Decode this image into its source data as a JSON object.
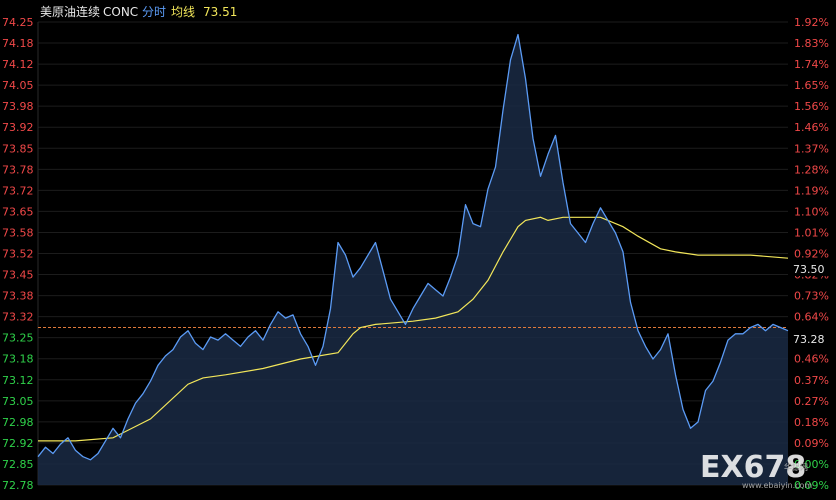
{
  "header": {
    "instrument": "美原油连续",
    "code": "CONC",
    "mode_label": "分时",
    "avg_label": "均线",
    "avg_value": "73.51"
  },
  "tags": {
    "avg_tag": "73.50",
    "price_tag": "73.28"
  },
  "watermark": {
    "brand": "EX678",
    "site_small": "www.ebaiyin.com",
    "cn_text": "华银网"
  },
  "colors": {
    "background": "#000000",
    "price_line": "#5b9bf5",
    "price_fill": "#1a2a44",
    "avg_line": "#f2e65a",
    "up": "#f04848",
    "down": "#2fd24a",
    "reference_line": "#e07a3a",
    "grid": "#1c1c1c"
  },
  "chart_data": {
    "type": "area",
    "title": "",
    "xlabel": "",
    "ylabel": "",
    "reference_price": 73.28,
    "ylim": [
      72.78,
      74.25
    ],
    "left_ticks": [
      "74.25",
      "74.18",
      "74.12",
      "74.05",
      "73.98",
      "73.92",
      "73.85",
      "73.78",
      "73.72",
      "73.65",
      "73.58",
      "73.52",
      "73.45",
      "73.38",
      "73.32",
      "73.25",
      "73.18",
      "73.12",
      "73.05",
      "72.98",
      "72.92",
      "72.85",
      "72.78"
    ],
    "right_ticks": [
      "1.92%",
      "1.83%",
      "1.74%",
      "1.65%",
      "1.56%",
      "1.46%",
      "1.37%",
      "1.28%",
      "1.19%",
      "1.10%",
      "1.01%",
      "0.92%",
      "0.82%",
      "0.73%",
      "0.64%",
      "0.55%",
      "0.46%",
      "0.37%",
      "0.27%",
      "0.18%",
      "0.09%",
      "0.00%",
      "0.09%"
    ],
    "series": [
      {
        "name": "分时",
        "x": [
          0,
          2,
          4,
          6,
          8,
          10,
          12,
          14,
          16,
          18,
          20,
          22,
          24,
          26,
          28,
          30,
          32,
          34,
          36,
          38,
          40,
          42,
          44,
          46,
          48,
          50,
          52,
          54,
          56,
          58,
          60,
          62,
          64,
          66,
          68,
          70,
          72,
          74,
          76,
          78,
          80,
          82,
          84,
          86,
          88,
          90,
          92,
          94,
          96,
          98,
          100,
          102,
          104,
          106,
          108,
          110,
          112,
          114,
          116,
          118,
          120,
          122,
          124,
          126,
          128,
          130,
          132,
          134,
          136,
          138,
          140,
          142,
          144,
          146,
          148,
          150,
          152,
          154,
          156,
          158,
          160,
          162,
          164,
          166,
          168,
          170,
          172,
          174,
          176,
          178,
          180,
          182,
          184,
          186,
          188,
          190,
          192,
          194,
          196,
          198,
          200
        ],
        "values": [
          72.87,
          72.9,
          72.88,
          72.91,
          72.93,
          72.89,
          72.87,
          72.86,
          72.88,
          72.92,
          72.96,
          72.93,
          72.99,
          73.04,
          73.07,
          73.11,
          73.16,
          73.19,
          73.21,
          73.25,
          73.27,
          73.23,
          73.21,
          73.25,
          73.24,
          73.26,
          73.24,
          73.22,
          73.25,
          73.27,
          73.24,
          73.29,
          73.33,
          73.31,
          73.32,
          73.26,
          73.22,
          73.16,
          73.22,
          73.34,
          73.55,
          73.51,
          73.44,
          73.47,
          73.51,
          73.55,
          73.46,
          73.37,
          73.33,
          73.29,
          73.34,
          73.38,
          73.42,
          73.4,
          73.38,
          73.44,
          73.51,
          73.67,
          73.61,
          73.6,
          73.72,
          73.79,
          73.97,
          74.13,
          74.21,
          74.07,
          73.88,
          73.76,
          73.83,
          73.89,
          73.74,
          73.61,
          73.58,
          73.55,
          73.61,
          73.66,
          73.62,
          73.58,
          73.52,
          73.36,
          73.27,
          73.22,
          73.18,
          73.21,
          73.26,
          73.13,
          73.02,
          72.96,
          72.98,
          73.08,
          73.11,
          73.17,
          73.24,
          73.26,
          73.26,
          73.28,
          73.29,
          73.27,
          73.29,
          73.28,
          73.27
        ]
      },
      {
        "name": "均线",
        "x": [
          0,
          10,
          20,
          30,
          40,
          44,
          50,
          60,
          70,
          80,
          84,
          86,
          90,
          100,
          106,
          112,
          116,
          120,
          124,
          128,
          130,
          134,
          136,
          140,
          144,
          150,
          156,
          160,
          166,
          170,
          176,
          180,
          186,
          190,
          200
        ],
        "values": [
          72.92,
          72.92,
          72.93,
          72.99,
          73.1,
          73.12,
          73.13,
          73.15,
          73.18,
          73.2,
          73.26,
          73.28,
          73.29,
          73.3,
          73.31,
          73.33,
          73.37,
          73.43,
          73.52,
          73.6,
          73.62,
          73.63,
          73.62,
          73.63,
          73.63,
          73.63,
          73.6,
          73.57,
          73.53,
          73.52,
          73.51,
          73.51,
          73.51,
          73.51,
          73.5
        ]
      }
    ]
  }
}
